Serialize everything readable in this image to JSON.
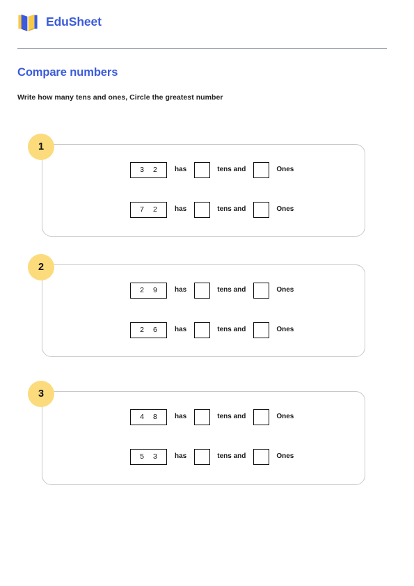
{
  "header": {
    "brand": "EduSheet",
    "logo_icon": "open-book-icon",
    "logo_colors": {
      "blue": "#3B5BDB",
      "yellow": "#F7C948"
    }
  },
  "worksheet": {
    "title": "Compare numbers",
    "title_color": "#3B5BDB",
    "instructions": "Write how many tens and ones, Circle the greatest number"
  },
  "labels": {
    "has": "has",
    "tens_and": "tens and",
    "ones": "Ones"
  },
  "badge_color": "#FBDB7C",
  "problems": [
    {
      "number": "1",
      "rows": [
        {
          "digit_tens": "3",
          "digit_ones": "2",
          "tens_answer": "",
          "ones_answer": ""
        },
        {
          "digit_tens": "7",
          "digit_ones": "2",
          "tens_answer": "",
          "ones_answer": ""
        }
      ]
    },
    {
      "number": "2",
      "rows": [
        {
          "digit_tens": "2",
          "digit_ones": "9",
          "tens_answer": "",
          "ones_answer": ""
        },
        {
          "digit_tens": "2",
          "digit_ones": "6",
          "tens_answer": "",
          "ones_answer": ""
        }
      ]
    },
    {
      "number": "3",
      "rows": [
        {
          "digit_tens": "4",
          "digit_ones": "8",
          "tens_answer": "",
          "ones_answer": ""
        },
        {
          "digit_tens": "5",
          "digit_ones": "3",
          "tens_answer": "",
          "ones_answer": ""
        }
      ]
    }
  ]
}
